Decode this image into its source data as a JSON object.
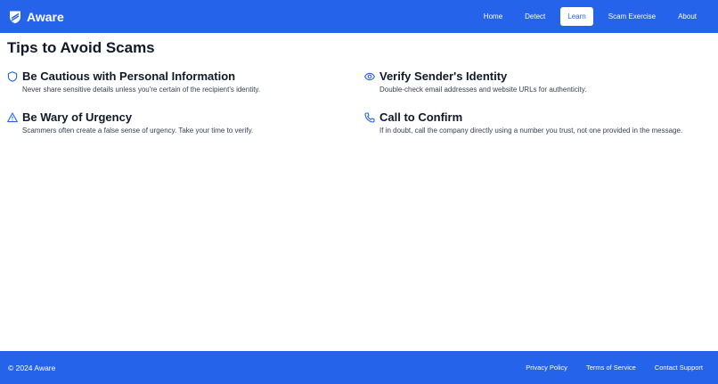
{
  "header": {
    "brand": "Aware",
    "brand_icon": "shield-logo-icon",
    "nav": [
      {
        "label": "Home"
      },
      {
        "label": "Detect"
      },
      {
        "label": "Learn",
        "active": true
      },
      {
        "label": "Scam Exercise"
      },
      {
        "label": "About"
      }
    ]
  },
  "main": {
    "title": "Tips to Avoid Scams",
    "tips": [
      {
        "icon": "shield-icon",
        "title": "Be Cautious with Personal Information",
        "description": "Never share sensitive details unless you're certain of the recipient's identity."
      },
      {
        "icon": "eye-icon",
        "title": "Verify Sender's Identity",
        "description": "Double-check email addresses and website URLs for authenticity."
      },
      {
        "icon": "warning-icon",
        "title": "Be Wary of Urgency",
        "description": "Scammers often create a false sense of urgency. Take your time to verify."
      },
      {
        "icon": "phone-icon",
        "title": "Call to Confirm",
        "description": "If in doubt, call the company directly using a number you trust, not one provided in the message."
      }
    ]
  },
  "footer": {
    "copyright": "© 2024 Aware",
    "links": [
      {
        "label": "Privacy Policy"
      },
      {
        "label": "Terms of Service"
      },
      {
        "label": "Contact Support"
      }
    ]
  },
  "colors": {
    "primary": "#2563eb",
    "text": "#111827",
    "muted": "#374151",
    "background": "#ffffff"
  }
}
